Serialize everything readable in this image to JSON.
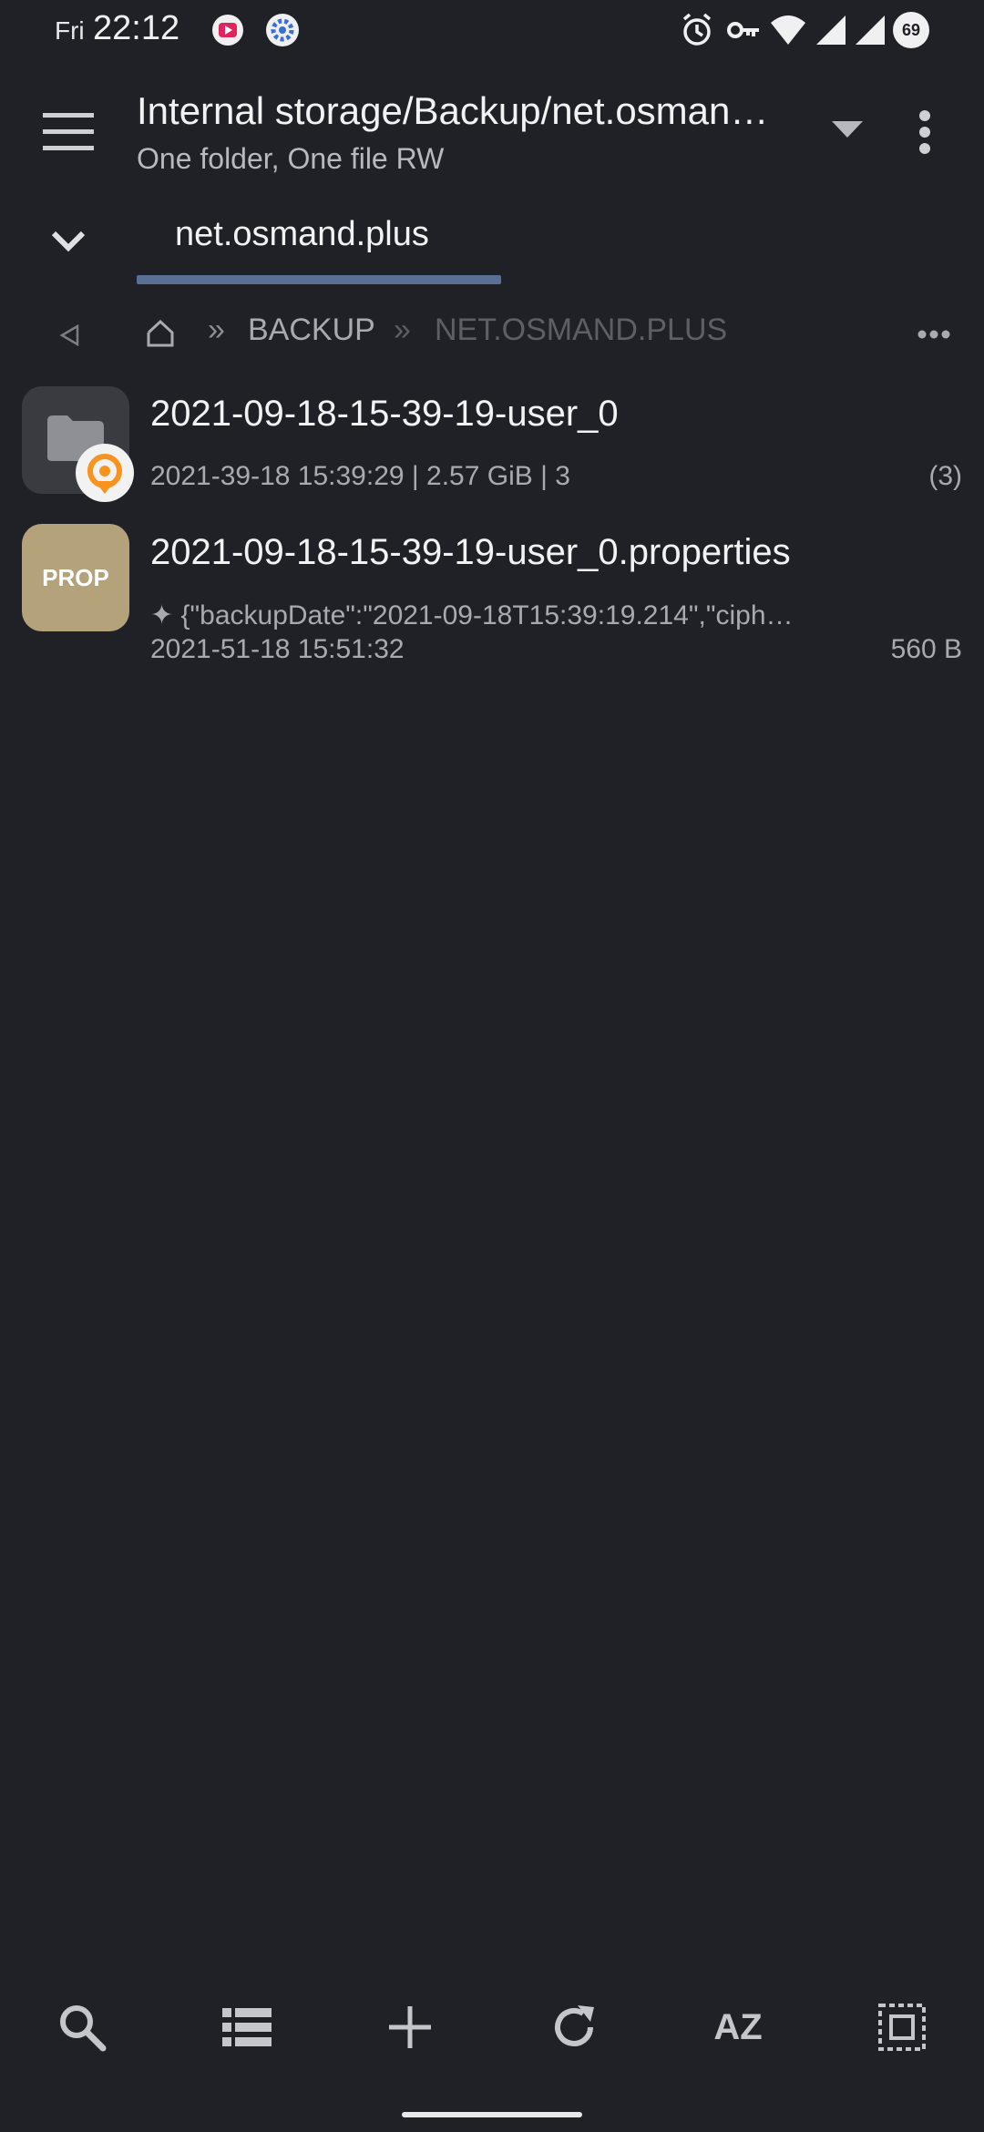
{
  "status_bar": {
    "day": "Fri",
    "time": "22:12",
    "battery": "69",
    "icons": [
      "youtube-notification-icon",
      "settings-notification-icon",
      "alarm-icon",
      "vpn-key-icon",
      "wifi-icon",
      "signal-icon",
      "signal-icon-2",
      "battery-icon"
    ]
  },
  "header": {
    "title": "Internal storage/Backup/net.osman…",
    "subtitle": "One folder, One file RW",
    "menu_icon": "hamburger-menu-icon",
    "dropdown_icon": "dropdown-triangle-icon",
    "overflow_icon": "more-vertical-icon"
  },
  "tabs": [
    {
      "label": "net.osmand.plus",
      "active": true
    }
  ],
  "breadcrumb": {
    "back_icon": "back-triangle-icon",
    "home_icon": "home-icon",
    "separator": "»",
    "items": [
      "BACKUP",
      "NET.OSMAND.PLUS"
    ],
    "more_icon": "more-horizontal-icon"
  },
  "files": [
    {
      "type": "folder",
      "name": "2021-09-18-15-39-19-user_0",
      "meta": "2021-39-18 15:39:29 | 2.57 GiB | 3",
      "count": "(3)"
    },
    {
      "type": "file",
      "badge": "PROP",
      "name": "2021-09-18-15-39-19-user_0.properties",
      "preview": "✦ {\"backupDate\":\"2021-09-18T15:39:19.214\",\"ciph…",
      "date": "2021-51-18 15:51:32",
      "size": "560 B"
    }
  ],
  "toolbar": {
    "sort_label": "AZ",
    "icons": [
      "search-icon",
      "list-view-icon",
      "add-icon",
      "refresh-icon",
      "sort-az-icon",
      "select-all-icon"
    ]
  },
  "colors": {
    "background": "#202126",
    "accent": "#5a6f95",
    "prop_badge": "#b3a27a",
    "osmand_orange": "#f7931e"
  }
}
